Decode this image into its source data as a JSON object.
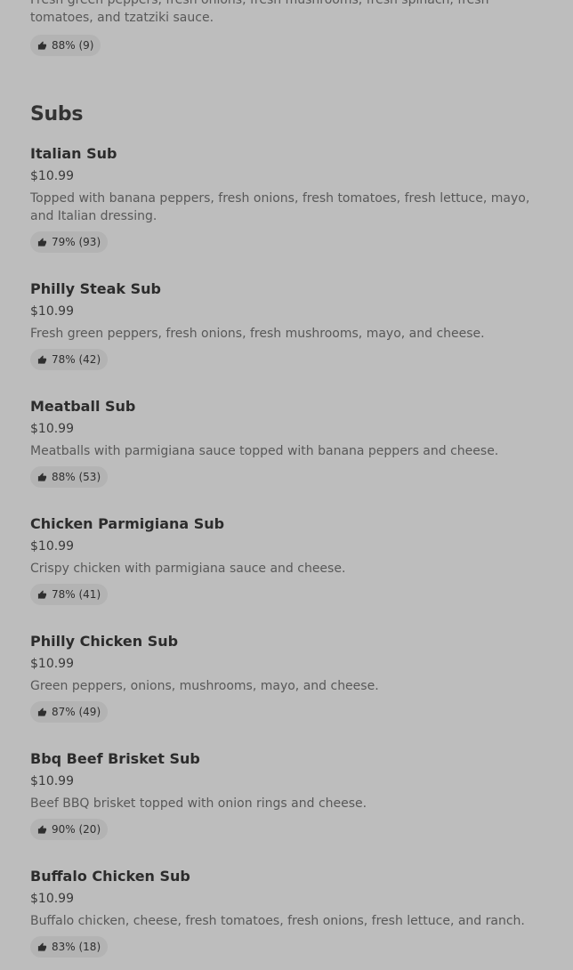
{
  "previous_item": {
    "description": "Fresh green peppers, fresh onions, fresh mushrooms, fresh spinach, fresh tomatoes, and tzatziki sauce.",
    "rating": "88% (9)"
  },
  "section": {
    "title": "Subs"
  },
  "items": [
    {
      "name": "Italian Sub",
      "price": "$10.99",
      "description": "Topped with banana peppers, fresh onions, fresh tomatoes, fresh lettuce, mayo, and Italian dressing.",
      "rating": "79% (93)"
    },
    {
      "name": "Philly Steak Sub",
      "price": "$10.99",
      "description": "Fresh green peppers, fresh onions, fresh mushrooms, mayo, and cheese.",
      "rating": "78% (42)"
    },
    {
      "name": "Meatball Sub",
      "price": "$10.99",
      "description": "Meatballs with parmigiana sauce topped with banana peppers and cheese.",
      "rating": "88% (53)"
    },
    {
      "name": "Chicken Parmigiana Sub",
      "price": "$10.99",
      "description": "Crispy chicken with parmigiana sauce and cheese.",
      "rating": "78% (41)"
    },
    {
      "name": "Philly Chicken Sub",
      "price": "$10.99",
      "description": "Green peppers, onions, mushrooms, mayo, and cheese.",
      "rating": "87% (49)"
    },
    {
      "name": "Bbq Beef Brisket Sub",
      "price": "$10.99",
      "description": "Beef BBQ brisket topped with onion rings and cheese.",
      "rating": "90% (20)"
    },
    {
      "name": "Buffalo Chicken Sub",
      "price": "$10.99",
      "description": "Buffalo chicken, cheese, fresh tomatoes, fresh onions, fresh lettuce, and ranch.",
      "rating": "83% (18)"
    }
  ],
  "icons": {
    "rating_icon": "thumbs-up-icon"
  }
}
